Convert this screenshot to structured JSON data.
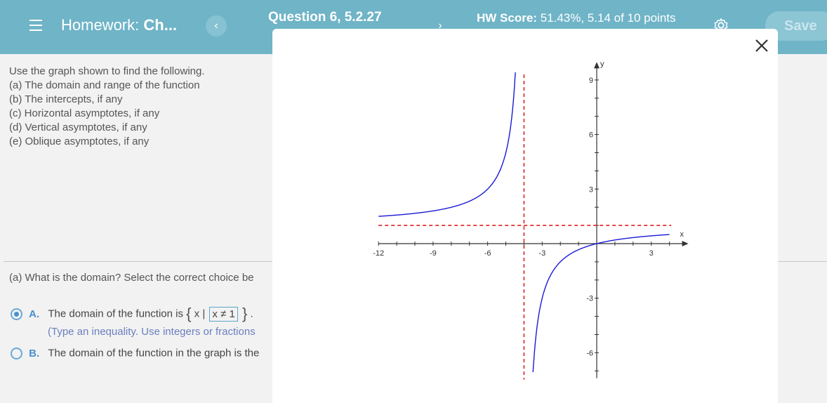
{
  "header": {
    "menu_icon": "hamburger-menu-icon",
    "homework_prefix": "Homework:",
    "homework_name": "Ch...",
    "prev_label": "‹",
    "next_label": "›",
    "question_title": "Question 6, 5.2.27",
    "score_label": "HW Score:",
    "score_value": "51.43%, 5.14 of 10 points",
    "settings_icon": "gear-icon",
    "save_label": "Save"
  },
  "question": {
    "intro": "Use the graph shown to find the following.",
    "items": [
      "(a) The domain and range of the function",
      "(b) The intercepts, if any",
      "(c) Horizontal asymptotes, if any",
      "(d) Vertical asymptotes, if any",
      "(e) Oblique asymptotes, if any"
    ],
    "part_a": "(a) What is the domain? Select the correct choice be",
    "choices": [
      {
        "letter": "A.",
        "text": "The domain of the function is",
        "set_open": "{",
        "set_var": "x |",
        "answer": "x ≠ 1",
        "set_close": "}",
        "suffix": ".",
        "hint": "(Type an inequality. Use integers or fractions",
        "selected": true
      },
      {
        "letter": "B.",
        "text": "The domain of the function in the graph is the",
        "selected": false
      }
    ]
  },
  "modal": {
    "close_icon": "close-icon"
  },
  "chart_data": {
    "type": "line",
    "xlabel": "x",
    "ylabel": "y",
    "xlim": [
      -12,
      4.5
    ],
    "ylim": [
      -7,
      9.5
    ],
    "x_ticks": [
      -12,
      -9,
      -6,
      -3,
      3
    ],
    "y_ticks": [
      9,
      6,
      3,
      -3,
      -6
    ],
    "x_tick_labels": [
      "-12",
      "-9",
      "-6",
      "-3",
      "3"
    ],
    "y_tick_labels": [
      "9",
      "6",
      "3",
      "-3",
      "-6"
    ],
    "vertical_asymptote_x": -4,
    "horizontal_asymptote_y": 1,
    "function": "y = x/(x+4)",
    "curve_color": "#1a1ad6",
    "asymptote_color": "#e02020",
    "series": [
      {
        "x": [
          -12,
          -11,
          -10,
          -9,
          -8,
          -7,
          -6,
          -5.5,
          -5,
          -4.8,
          -4.6,
          -4.5,
          -4.45
        ],
        "y": [
          1.5,
          1.571,
          1.667,
          1.8,
          2,
          2.333,
          3,
          3.667,
          5,
          6,
          7.667,
          9,
          9.889
        ]
      },
      {
        "x": [
          -3.58,
          -3.6,
          -3.5,
          -3.3,
          -3,
          -2.5,
          -2,
          -1,
          0,
          1,
          2,
          3,
          4
        ],
        "y": [
          -8.52,
          -9,
          -7,
          -4.714,
          -3,
          -1.667,
          -1,
          -0.333,
          0,
          0.2,
          0.333,
          0.429,
          0.5
        ]
      }
    ]
  }
}
